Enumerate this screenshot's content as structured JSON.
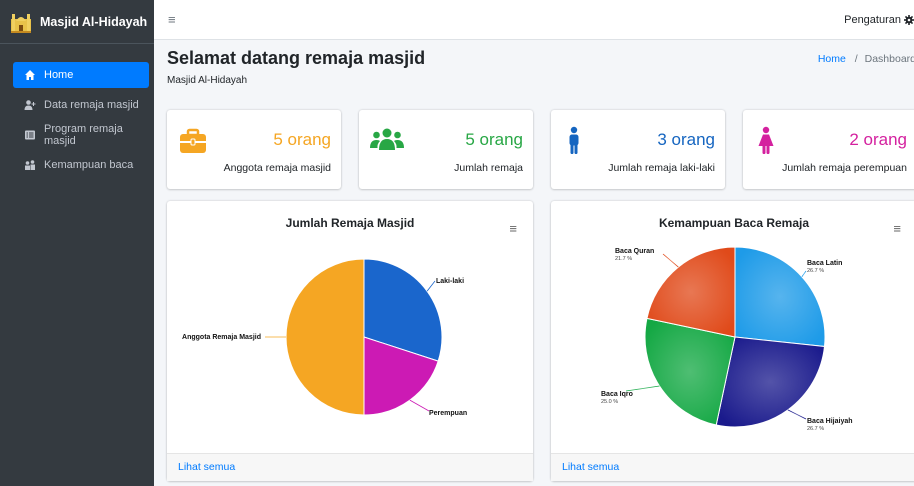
{
  "brand": {
    "name": "Masjid Al-Hidayah"
  },
  "sidebar": {
    "items": [
      {
        "label": "Home",
        "icon": "home-icon",
        "active": true
      },
      {
        "label": "Data remaja masjid",
        "icon": "user-plus-icon",
        "active": false
      },
      {
        "label": "Program remaja masjid",
        "icon": "list-icon",
        "active": false
      },
      {
        "label": "Kemampuan baca",
        "icon": "people-icon",
        "active": false
      }
    ]
  },
  "topbar": {
    "settings_label": "Pengaturan",
    "menu_icon": "hamburger-icon",
    "settings_icon": "gear-icon"
  },
  "page": {
    "title": "Selamat datang remaja masjid",
    "subtitle": "Masjid Al-Hidayah"
  },
  "breadcrumb": {
    "home": "Home",
    "separator": "/",
    "current": "Dashboard"
  },
  "stats": [
    {
      "value": "5 orang",
      "label": "Anggota remaja masjid",
      "color": "#f5a623",
      "icon": "briefcase-icon"
    },
    {
      "value": "5 orang",
      "label": "Jumlah remaja",
      "color": "#28a745",
      "icon": "users-icon"
    },
    {
      "value": "3 orang",
      "label": "Jumlah remaja laki-laki",
      "color": "#1565c0",
      "icon": "male-icon"
    },
    {
      "value": "2 orang",
      "label": "Jumlah remaja perempuan",
      "color": "#d4219f",
      "icon": "female-icon"
    }
  ],
  "charts": {
    "left": {
      "title": "Jumlah Remaja Masjid",
      "footer": "Lihat semua"
    },
    "right": {
      "title": "Kemampuan Baca Remaja",
      "footer": "Lihat semua"
    }
  },
  "chart_data": [
    {
      "type": "pie",
      "title": "Jumlah Remaja Masjid",
      "labels": [
        "Laki-laki",
        "Perempuan",
        "Anggota Remaja Masjid"
      ],
      "values": [
        3,
        2,
        5
      ],
      "colors": [
        "#1a66cc",
        "#cc1ab4",
        "#f5a623"
      ]
    },
    {
      "type": "pie",
      "title": "Kemampuan Baca Remaja",
      "labels": [
        "Baca Latin",
        "Baca Hijaiyah",
        "Baca Iqro",
        "Baca Quran"
      ],
      "values": [
        26.7,
        26.7,
        25.0,
        21.7
      ],
      "value_labels": [
        "26.7 %",
        "26.7 %",
        "25.0 %",
        "21.7 %"
      ],
      "colors": [
        "#1e9be8",
        "#1a1a8c",
        "#14a844",
        "#e04a1a"
      ]
    }
  ]
}
